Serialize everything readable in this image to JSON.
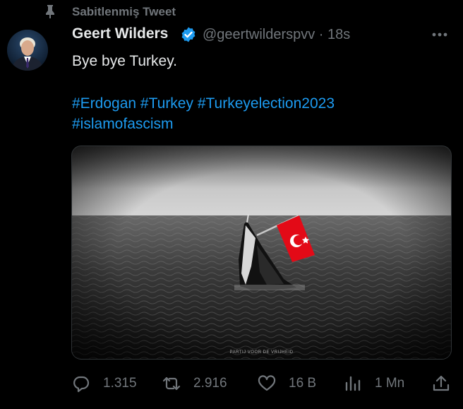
{
  "pinned_label": "Sabitlenmiş Tweet",
  "author": {
    "name": "Geert Wilders",
    "handle_time": "@geertwilderspvv · 18s"
  },
  "tweet": {
    "text": "Bye bye Turkey.",
    "hashtags_line1": "#Erdogan #Turkey #Turkeyelection2023",
    "hashtags_line2": "#islamofascism"
  },
  "media": {
    "watermark": "PARTIJ VOOR DE VRIJHEID"
  },
  "actions": {
    "reply_count": "1.315",
    "retweet_count": "2.916",
    "like_count": "16 B",
    "views_count": "1 Mn"
  },
  "colors": {
    "background": "#000000",
    "text": "#e7e9ea",
    "muted": "#71767b",
    "link": "#1d9bf0",
    "verified": "#1d9bf0",
    "flag": "#e30a17"
  },
  "icons": [
    "pin-icon",
    "verified-icon",
    "more-icon",
    "reply-icon",
    "retweet-icon",
    "like-icon",
    "views-icon",
    "share-icon"
  ]
}
